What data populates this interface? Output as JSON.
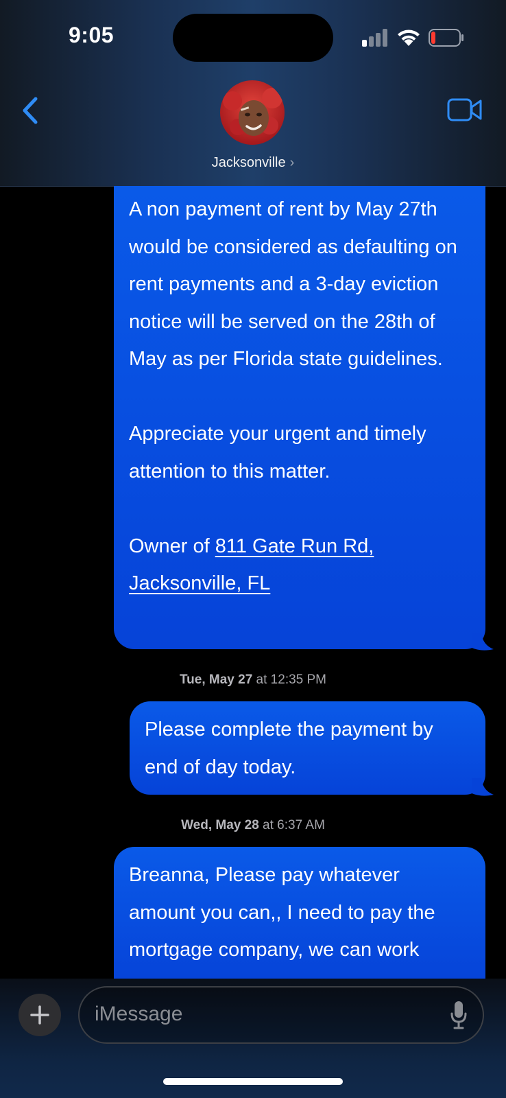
{
  "status_bar": {
    "time": "9:05",
    "signal_icon": "cellular-signal-icon",
    "wifi_icon": "wifi-icon",
    "battery_icon": "battery-low-icon",
    "battery_level": 0.15,
    "battery_color": "#ff3b30"
  },
  "header": {
    "back_icon": "chevron-left-icon",
    "contact_name": "Jacksonville",
    "contact_chevron": "›",
    "video_icon": "video-camera-icon",
    "accent_color": "#0a84ff"
  },
  "messages": [
    {
      "direction": "outgoing",
      "paragraphs": [
        "A non payment of rent by May 27th would be considered as defaulting on rent payments and a 3-day eviction notice will be served on the 28th of May as per Florida state guidelines.",
        "Appreciate your urgent and timely attention to this matter."
      ],
      "signature_prefix": "Owner of ",
      "signature_link": "811 Gate Run Rd, Jacksonville, FL"
    },
    {
      "timestamp_day": "Tue, May 27",
      "timestamp_time": " at 12:35 PM",
      "direction": "outgoing",
      "text": "Please complete the payment by end of day today."
    },
    {
      "timestamp_day": "Wed, May 28",
      "timestamp_time": " at 6:37 AM",
      "direction": "outgoing",
      "text": "Breanna, Please pay whatever amount you can,, I need to pay the mortgage company, we can work"
    }
  ],
  "bubble_color": "#0a5ae8",
  "composer": {
    "plus_icon": "plus-icon",
    "placeholder": "iMessage",
    "mic_icon": "microphone-icon"
  }
}
